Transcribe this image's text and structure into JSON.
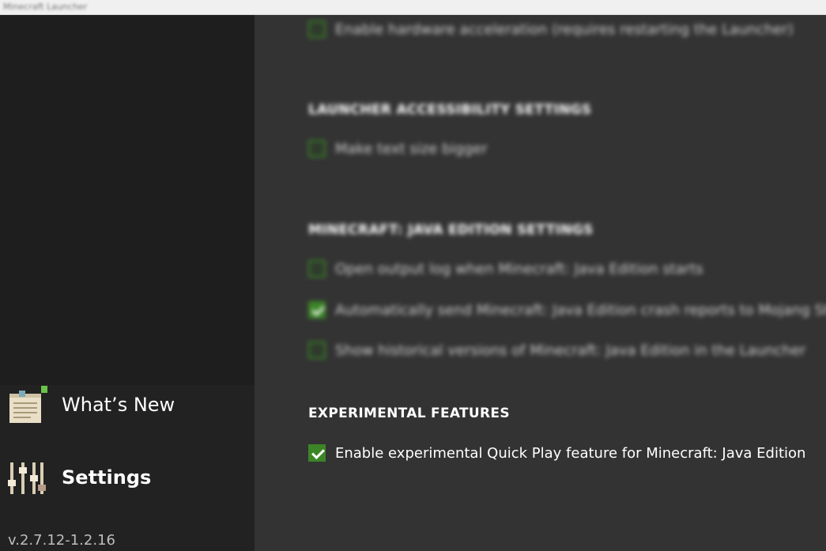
{
  "titlebar": {
    "title": "Minecraft Launcher"
  },
  "sidebar": {
    "items": [
      {
        "label": "What’s New",
        "icon": "notepad-icon",
        "active": false
      },
      {
        "label": "Settings",
        "icon": "sliders-icon",
        "active": true
      }
    ],
    "version": "v.2.7.12-1.2.16"
  },
  "settings": {
    "blurred_sections": [
      {
        "heading": "",
        "options": [
          {
            "label": "Enable hardware acceleration (requires restarting the Launcher)",
            "checked": false
          }
        ]
      },
      {
        "heading": "LAUNCHER ACCESSIBILITY SETTINGS",
        "options": [
          {
            "label": "Make text size bigger",
            "checked": false
          }
        ]
      },
      {
        "heading": "MINECRAFT: JAVA EDITION SETTINGS",
        "options": [
          {
            "label": "Open output log when Minecraft: Java Edition starts",
            "checked": false
          },
          {
            "label": "Automatically send Minecraft: Java Edition crash reports to Mojang Studios",
            "checked": true
          },
          {
            "label": "Show historical versions of Minecraft: Java Edition in the Launcher",
            "checked": false
          }
        ]
      }
    ],
    "experimental": {
      "heading": "EXPERIMENTAL FEATURES",
      "option_label": "Enable experimental Quick Play feature for Minecraft: Java Edition",
      "checked": true
    }
  },
  "colors": {
    "accent": "#3c8527",
    "sidebar_bg": "#1e1e1e",
    "main_bg": "#333333"
  }
}
